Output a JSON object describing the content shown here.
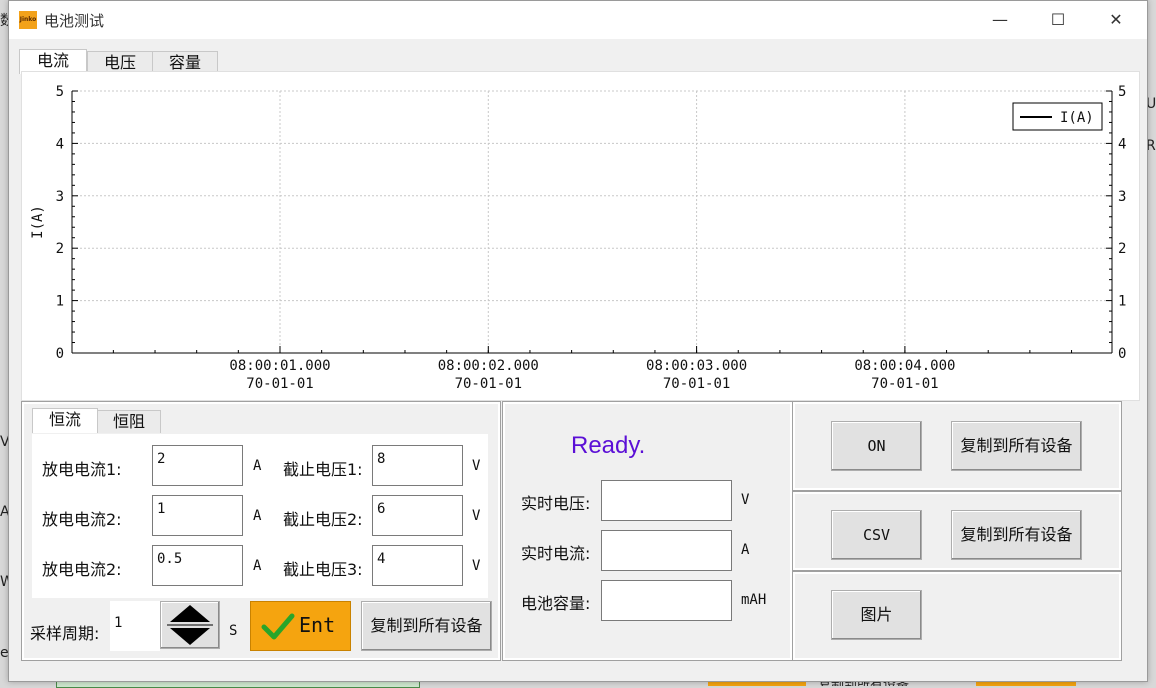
{
  "background": {
    "left_glyphs": [
      "数",
      "V",
      "A",
      "W",
      "e"
    ],
    "right_glyphs": [
      "U",
      "R"
    ],
    "bottom_right_text": "复制到所有设备"
  },
  "window": {
    "title": "电池测试",
    "icon_text": "Jinko",
    "controls": {
      "minimize": "—",
      "maximize": "☐",
      "close": "✕"
    }
  },
  "chart_tabs": [
    "电流",
    "电压",
    "容量"
  ],
  "chart_data": {
    "type": "line",
    "ylabel": "I(A)",
    "ylim": [
      0,
      5
    ],
    "yticks": [
      "0",
      "1",
      "2",
      "3",
      "4",
      "5"
    ],
    "xticks": [
      {
        "time": "08:00:01.000",
        "date": "70-01-01"
      },
      {
        "time": "08:00:02.000",
        "date": "70-01-01"
      },
      {
        "time": "08:00:03.000",
        "date": "70-01-01"
      },
      {
        "time": "08:00:04.000",
        "date": "70-01-01"
      }
    ],
    "series": [
      {
        "name": "I(A)",
        "values": []
      }
    ],
    "legend": "top-right",
    "grid": true,
    "colors": {
      "series": "#000000",
      "grid": "#c8c8c8"
    }
  },
  "mode_tabs": [
    "恒流",
    "恒阻"
  ],
  "params": {
    "rows": [
      {
        "left_label": "放电电流1:",
        "left_value": "2",
        "left_unit": "A",
        "right_label": "截止电压1:",
        "right_value": "8",
        "right_unit": "V"
      },
      {
        "left_label": "放电电流2:",
        "left_value": "1",
        "left_unit": "A",
        "right_label": "截止电压2:",
        "right_value": "6",
        "right_unit": "V"
      },
      {
        "left_label": "放电电流2:",
        "left_value": "0.5",
        "left_unit": "A",
        "right_label": "截止电压3:",
        "right_value": "4",
        "right_unit": "V"
      }
    ],
    "sample_label": "采样周期:",
    "sample_value": "1",
    "sample_unit": "S",
    "ent_label": "Ent",
    "copy_label": "复制到所有设备"
  },
  "status": {
    "ready_text": "Ready.",
    "ready_color": "#5b0fd6",
    "voltage_label": "实时电压:",
    "voltage_value": "",
    "voltage_unit": "V",
    "current_label": "实时电流:",
    "current_value": "",
    "current_unit": "A",
    "capacity_label": "电池容量:",
    "capacity_value": "",
    "capacity_unit": "mAH"
  },
  "actions": {
    "on_label": "ON",
    "csv_label": "CSV",
    "image_label": "图片",
    "copy_label": "复制到所有设备"
  }
}
